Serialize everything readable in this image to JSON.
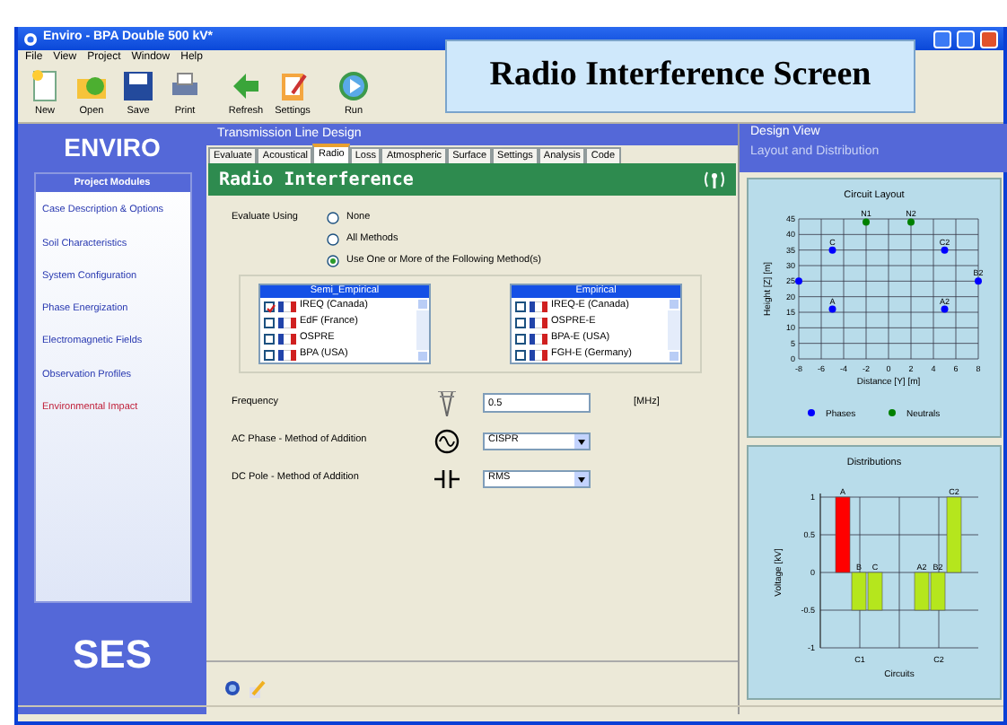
{
  "window": {
    "title": "Enviro - BPA Double 500 kV*"
  },
  "caption": "Radio Interference Screen",
  "menu": [
    "File",
    "View",
    "Project",
    "Window",
    "Help"
  ],
  "toolbar": [
    "New",
    "Open",
    "Save",
    "Print",
    "Refresh",
    "Settings",
    "Run"
  ],
  "sidebar": {
    "logo": "ENVIRO",
    "group_title": "Project Modules",
    "footer_logo": "SES",
    "items": [
      {
        "label": "Case Description & Options",
        "selected": false
      },
      {
        "label": "Soil Characteristics",
        "selected": false
      },
      {
        "label": "System Configuration",
        "selected": false
      },
      {
        "label": "Phase Energization",
        "selected": false
      },
      {
        "label": "Electromagnetic Fields",
        "selected": false
      },
      {
        "label": "Observation Profiles",
        "selected": false
      },
      {
        "label": "Environmental Impact",
        "selected": true
      }
    ]
  },
  "center": {
    "header": "Transmission Line Design",
    "tabs": [
      {
        "label": "Evaluate",
        "selected": false
      },
      {
        "label": "Acoustical",
        "selected": false
      },
      {
        "label": "Radio",
        "selected": true
      },
      {
        "label": "Loss",
        "selected": false
      },
      {
        "label": "Atmospheric",
        "selected": false
      },
      {
        "label": "Surface",
        "selected": false
      },
      {
        "label": "Settings",
        "selected": false
      },
      {
        "label": "Analysis",
        "selected": false
      },
      {
        "label": "Code",
        "selected": false
      }
    ],
    "banner": "Radio Interference",
    "evaluate_label": "Evaluate Using",
    "options": [
      {
        "label": "None",
        "selected": false
      },
      {
        "label": "All Methods",
        "selected": false
      },
      {
        "label": "Use One or More of the  Following Method(s)",
        "selected": true
      }
    ],
    "lists": [
      {
        "title": "Semi_Empirical",
        "items": [
          {
            "label": "IREQ (Canada)",
            "checked": true
          },
          {
            "label": "EdF (France)",
            "checked": false
          },
          {
            "label": "OSPRE",
            "checked": false
          },
          {
            "label": "BPA (USA)",
            "checked": false
          }
        ]
      },
      {
        "title": "Empirical",
        "items": [
          {
            "label": "IREQ-E (Canada)",
            "checked": false
          },
          {
            "label": "OSPRE-E",
            "checked": false
          },
          {
            "label": "BPA-E (USA)",
            "checked": false
          },
          {
            "label": "FGH-E (Germany)",
            "checked": false
          }
        ]
      }
    ],
    "frequency": {
      "label": "Frequency",
      "value": "0.5",
      "unit": "[MHz]"
    },
    "ac_phase": {
      "label": "AC Phase - Method of Addition",
      "value": "CISPR"
    },
    "dc_pole": {
      "label": "DC Pole - Method of Addition",
      "value": "RMS"
    }
  },
  "design_view": {
    "title": "Design View",
    "subtitle": "Layout and Distribution",
    "layout": {
      "chart_data": {
        "type": "scatter",
        "title": "Circuit Layout",
        "xlabel": "Distance [Y] [m]",
        "ylabel": "Height [Z] [m]",
        "xlim": [
          -8,
          8
        ],
        "ylim": [
          0,
          45
        ],
        "xticks": [
          -8,
          -6,
          -4,
          -2,
          0,
          2,
          4,
          6,
          8
        ],
        "yticks": [
          0,
          5,
          10,
          15,
          20,
          25,
          30,
          35,
          40,
          45
        ],
        "grid": true,
        "legend": "bottom",
        "series": [
          {
            "name": "Phases",
            "color": "#0000ff",
            "x": [
              -8,
              -5,
              -5,
              5,
              5,
              8
            ],
            "values": [
              25,
              16,
              35,
              35,
              16,
              25
            ]
          },
          {
            "name": "Neutrals",
            "color": "#008000",
            "x": [
              -2,
              2
            ],
            "values": [
              44,
              44
            ]
          }
        ],
        "annotations": [
          {
            "x": -5,
            "y": 35,
            "text": "C"
          },
          {
            "x": -5,
            "y": 16,
            "text": "A"
          },
          {
            "x": -2,
            "y": 44,
            "text": "N1"
          },
          {
            "x": 2,
            "y": 44,
            "text": "N2"
          },
          {
            "x": 5,
            "y": 35,
            "text": "C2"
          },
          {
            "x": 5,
            "y": 16,
            "text": "A2"
          },
          {
            "x": 8,
            "y": 25,
            "text": "B2"
          }
        ]
      }
    },
    "distribution": {
      "chart_data": {
        "type": "bar",
        "title": "Distributions",
        "xlabel": "Circuits",
        "ylabel": "Voltage [kV]",
        "categories": [
          "C1",
          "C2"
        ],
        "ylim": [
          -1,
          1
        ],
        "yticks": [
          {
            "value": -1,
            "label": "-1"
          },
          {
            "value": -0.5,
            "label": "-0.5"
          },
          {
            "value": 0,
            "label": "0"
          },
          {
            "value": 0.5,
            "label": "0.5"
          },
          {
            "value": 1,
            "label": "1"
          }
        ],
        "grid": true,
        "series": [
          {
            "name": "A",
            "color": "#ff0000",
            "values": [
              1,
              null
            ]
          },
          {
            "name": "B",
            "color": "#b5e61d",
            "values": [
              -0.5,
              null
            ]
          },
          {
            "name": "C",
            "color": "#b5e61d",
            "values": [
              -0.5,
              null
            ]
          },
          {
            "name": "A2",
            "color": "#b5e61d",
            "values": [
              null,
              -0.5
            ]
          },
          {
            "name": "B2",
            "color": "#b5e61d",
            "values": [
              null,
              -0.5
            ]
          },
          {
            "name": "C2",
            "color": "#b5e61d",
            "values": [
              null,
              1
            ]
          }
        ]
      }
    }
  }
}
